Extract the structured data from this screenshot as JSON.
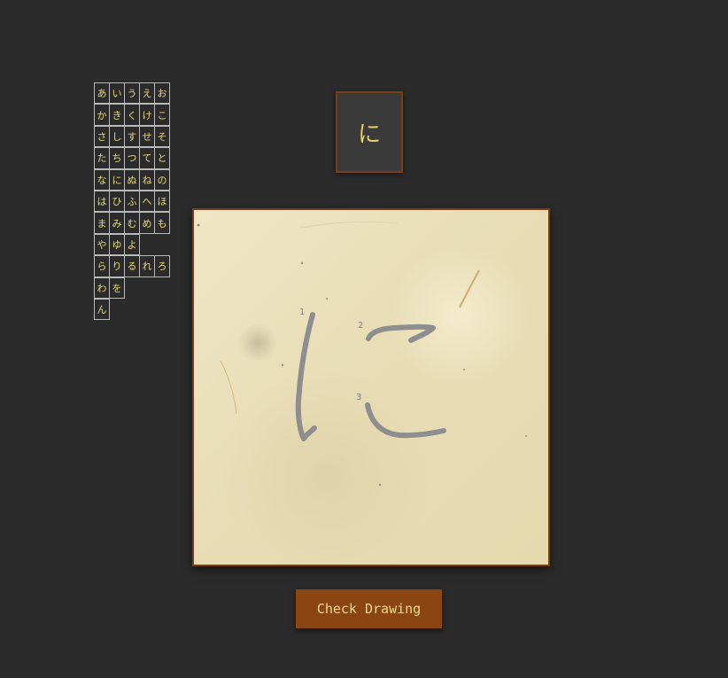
{
  "kana_rows": [
    [
      "あ",
      "い",
      "う",
      "え",
      "お"
    ],
    [
      "か",
      "き",
      "く",
      "け",
      "こ"
    ],
    [
      "さ",
      "し",
      "す",
      "せ",
      "そ"
    ],
    [
      "た",
      "ち",
      "つ",
      "て",
      "と"
    ],
    [
      "な",
      "に",
      "ぬ",
      "ね",
      "の"
    ],
    [
      "は",
      "ひ",
      "ふ",
      "へ",
      "ほ"
    ],
    [
      "ま",
      "み",
      "む",
      "め",
      "も"
    ],
    [
      "や",
      "ゆ",
      "よ"
    ],
    [
      "ら",
      "り",
      "る",
      "れ",
      "ろ"
    ],
    [
      "わ",
      "を"
    ],
    [
      "ん"
    ]
  ],
  "target_character": "に",
  "stroke_numbers": [
    "1",
    "2",
    "3"
  ],
  "check_button_label": "Check Drawing",
  "colors": {
    "background": "#2b2b2b",
    "kana_text": "#e9d77e",
    "accent_brown": "#8b4513",
    "stroke_guide": "#8e8e8e"
  }
}
